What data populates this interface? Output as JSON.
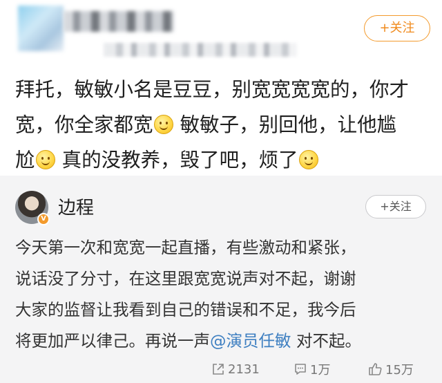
{
  "post": {
    "follow_label": "+关注",
    "line1": "拜托，敏敏小名是豆豆，别宽宽宽宽的，你才",
    "line2a": "宽，你全家都宽",
    "line2b": "敏敏子，别回他，让他尴",
    "line3a": "尬",
    "line3b": "真的没教养，毁了吧，烦了"
  },
  "repost": {
    "author": "边程",
    "follow_label": "+关注",
    "line1": "今天第一次和宽宽一起直播，有些激动和紧张，",
    "line2": "说话没了分寸，在这里跟宽宽说声对不起，谢谢",
    "line3": "大家的监督让我看到自己的错误和不足，我今后",
    "line4a": "将更加严以律己。再说一声",
    "mention": "@演员任敏",
    "line4b": " 对不起。"
  },
  "actions": {
    "repost_count": "2131",
    "comment_count": "1万",
    "like_count": "15万"
  },
  "colors": {
    "accent_orange": "#f39a2c",
    "link_blue": "#3e7fc1",
    "repost_bg": "#f4f4f5"
  }
}
